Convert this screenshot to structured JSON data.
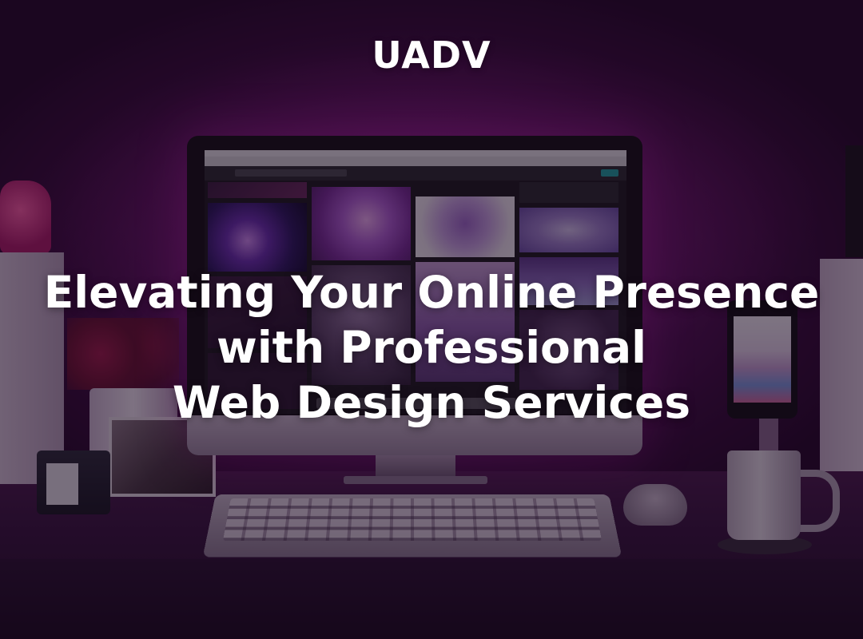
{
  "brand": {
    "name": "UADV"
  },
  "hero": {
    "headline_lines": [
      "Elevating Your Online Presence",
      "with Professional",
      "Web Design Services"
    ]
  },
  "background": {
    "image_description": "Desk setup with monitor, keyboard, mug and phone in magenta lighting",
    "icons": [
      "monitor-icon",
      "keyboard-icon",
      "mouse-icon",
      "mug-icon",
      "phone-icon"
    ]
  },
  "colors": {
    "text": "#ffffff",
    "accent_magenta": "#8a1f86",
    "overlay": "#140618"
  }
}
